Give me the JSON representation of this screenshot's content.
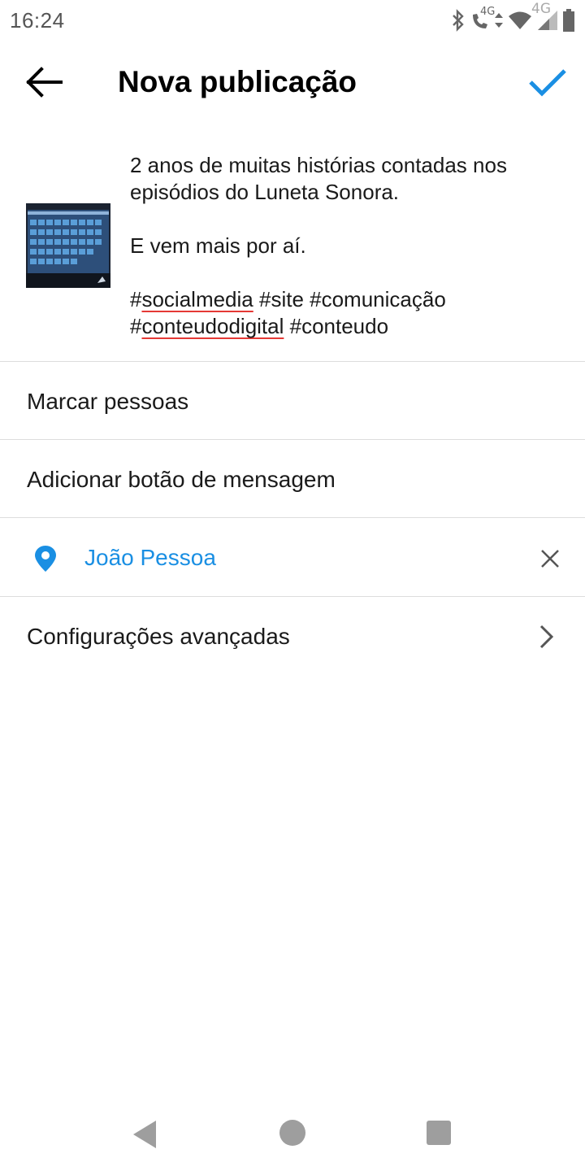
{
  "status_bar": {
    "time": "16:24",
    "network_small": "4G",
    "network_label": "4G",
    "icons": [
      "bluetooth-icon",
      "call-icon",
      "data-arrows-icon",
      "wifi-icon",
      "signal-icon",
      "battery-icon"
    ]
  },
  "header": {
    "title": "Nova publicação",
    "back_icon": "arrow-left-icon",
    "confirm_icon": "checkmark-icon",
    "accent_color": "#1a8fe3"
  },
  "post": {
    "caption_lines": [
      "2 anos de muitas histórias contadas nos",
      "episódios do Luneta Sonora.",
      "",
      "E vem mais por aí.",
      ""
    ],
    "tags_line1": {
      "hash1": "#",
      "tag1": "socialmedia",
      "rest": " #site #comunicação"
    },
    "tags_line2": {
      "hash": "#",
      "tag": "conteudodigital",
      "rest": " #conteudo"
    }
  },
  "options": {
    "tag_people": "Marcar pessoas",
    "add_message_button": "Adicionar botão de mensagem",
    "location": "João Pessoa",
    "advanced_settings": "Configurações avançadas"
  },
  "navbar": {
    "icons": [
      "nav-back-icon",
      "nav-home-icon",
      "nav-recents-icon"
    ]
  }
}
